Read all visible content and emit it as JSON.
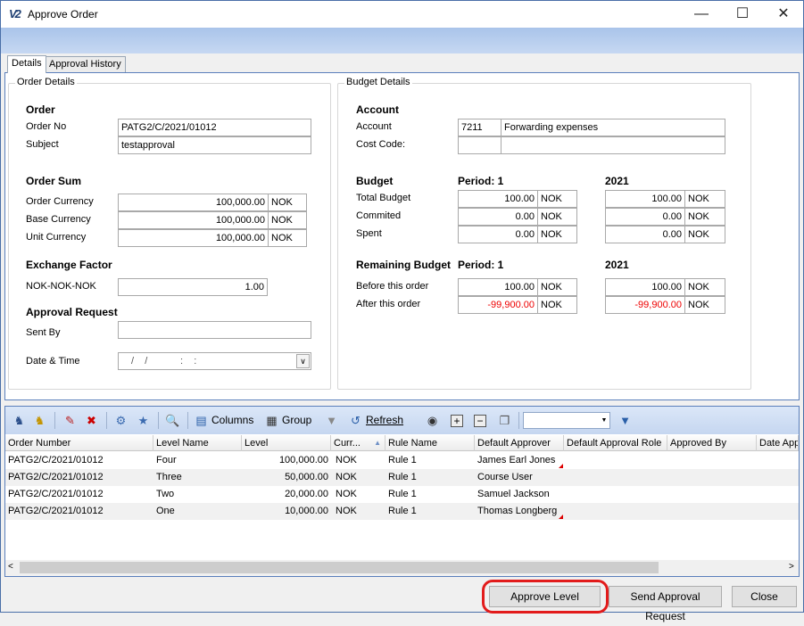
{
  "window": {
    "title": "Approve Order",
    "logo": "V2"
  },
  "tabs": [
    "Details",
    "Approval History"
  ],
  "order_details": {
    "group_title": "Order Details",
    "order_header": "Order",
    "order_no_label": "Order No",
    "order_no": "PATG2/C/2021/01012",
    "subject_label": "Subject",
    "subject": "testapproval",
    "sum_header": "Order Sum",
    "order_currency_label": "Order Currency",
    "order_currency_value": "100,000.00",
    "order_currency_cur": "NOK",
    "base_currency_label": "Base Currency",
    "base_currency_value": "100,000.00",
    "base_currency_cur": "NOK",
    "unit_currency_label": "Unit Currency",
    "unit_currency_value": "100,000.00",
    "unit_currency_cur": "NOK",
    "exchange_header": "Exchange Factor",
    "exchange_label": "NOK-NOK-NOK",
    "exchange_value": "1.00",
    "approval_header": "Approval Request",
    "sent_by_label": "Sent By",
    "sent_by": "",
    "date_time_label": "Date & Time",
    "date_time": "/    /            :    :"
  },
  "budget_details": {
    "group_title": "Budget Details",
    "account_header": "Account",
    "account_label": "Account",
    "account_code": "7211",
    "account_name": "Forwarding expenses",
    "cost_code_label": "Cost Code:",
    "cost_code": "",
    "cost_code_name": "",
    "budget_header": "Budget",
    "period_header": "Period: 1",
    "year_header": "2021",
    "total_budget_label": "Total Budget",
    "commited_label": "Commited",
    "spent_label": "Spent",
    "period_values": [
      "100.00",
      "0.00",
      "0.00"
    ],
    "year_values": [
      "100.00",
      "0.00",
      "0.00"
    ],
    "currency": "NOK",
    "remaining_header": "Remaining Budget",
    "remaining_period_header": "Period: 1",
    "remaining_year_header": "2021",
    "before_label": "Before this order",
    "after_label": "After this order",
    "before_period": "100.00",
    "after_period": "-99,900.00",
    "before_year": "100.00",
    "after_year": "-99,900.00"
  },
  "toolbar": {
    "columns": "Columns",
    "group": "Group",
    "refresh": "Refresh",
    "combo_value": ""
  },
  "grid": {
    "columns": [
      "Order Number",
      "Level Name",
      "Level",
      "Curr...",
      "Rule Name",
      "Default Approver",
      "Default Approval Role",
      "Approved By",
      "Date App"
    ],
    "rows": [
      {
        "order": "PATG2/C/2021/01012",
        "level_name": "Four",
        "level": "100,000.00",
        "curr": "NOK",
        "rule": "Rule 1",
        "approver": "James Earl Jones"
      },
      {
        "order": "PATG2/C/2021/01012",
        "level_name": "Three",
        "level": "50,000.00",
        "curr": "NOK",
        "rule": "Rule 1",
        "approver": "Course User"
      },
      {
        "order": "PATG2/C/2021/01012",
        "level_name": "Two",
        "level": "20,000.00",
        "curr": "NOK",
        "rule": "Rule 1",
        "approver": "Samuel Jackson"
      },
      {
        "order": "PATG2/C/2021/01012",
        "level_name": "One",
        "level": "10,000.00",
        "curr": "NOK",
        "rule": "Rule 1",
        "approver": "Thomas Longberg"
      }
    ]
  },
  "buttons": {
    "approve": "Approve Level",
    "send": "Send Approval Request",
    "close": "Close"
  },
  "colors": {
    "accent": "#5a7fbb",
    "negative": "#e00000",
    "highlight": "#e21b1b"
  }
}
